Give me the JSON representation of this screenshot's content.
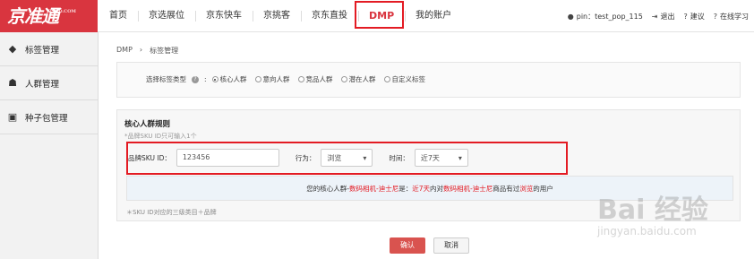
{
  "topbar": {
    "logo_text": "京准通",
    "logo_sub": "JZT.JD.COM",
    "nav": [
      "首页",
      "京选展位",
      "京东快车",
      "京挑客",
      "京东直投",
      "DMP",
      "我的账户"
    ],
    "active_nav": "DMP",
    "user": "pin：test_pop_115",
    "logout": "退出",
    "suggest": "建议",
    "learn": "在线学习"
  },
  "sidebar": {
    "items": [
      {
        "label": "标签管理",
        "icon": "tag-icon"
      },
      {
        "label": "人群管理",
        "icon": "users-icon"
      },
      {
        "label": "种子包管理",
        "icon": "briefcase-icon"
      }
    ]
  },
  "breadcrumb": {
    "root": "DMP",
    "sep": "›",
    "current": "标签管理"
  },
  "tag_type": {
    "label": "选择标签类型",
    "help": "?",
    "options": [
      "核心人群",
      "意向人群",
      "竞品人群",
      "潜在人群",
      "自定义标签"
    ],
    "selected": "核心人群"
  },
  "rule": {
    "title": "核心人群规则",
    "hint": "*品牌SKU ID只可输入1个",
    "sku_label": "品牌SKU ID：",
    "sku_value": "123456",
    "action_label": "行为：",
    "action_value": "浏览",
    "time_label": "时间：",
    "time_value": "近7天",
    "desc_parts": [
      "您的核心人群-",
      "数码相机-迪士尼",
      "是：",
      "近7天",
      "内对",
      "数码相机-迪士尼",
      "商品有过",
      "浏览",
      "的用户"
    ],
    "note": "＊SKU ID对应的三级类目＋品牌"
  },
  "buttons": {
    "confirm": "确认",
    "cancel": "取消"
  },
  "colors": {
    "brand": "#d9353f",
    "highlight": "#e31b23",
    "confirm": "#d9534f"
  },
  "watermark": {
    "main": "Bai 经验",
    "sub": "jingyan.baidu.com"
  }
}
